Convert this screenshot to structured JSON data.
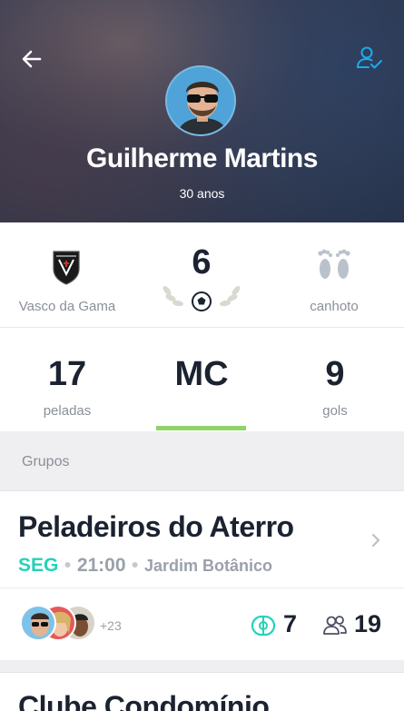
{
  "profile": {
    "name": "Guilherme Martins",
    "age": "30 anos",
    "club": "Vasco da Gama",
    "shirt_number": "6",
    "foot": "canhoto"
  },
  "stats": {
    "games_value": "17",
    "games_label": "peladas",
    "position": "MC",
    "goals_value": "9",
    "goals_label": "gols"
  },
  "groups_section": {
    "label": "Grupos"
  },
  "groups": [
    {
      "name": "Peladeiros do Aterro",
      "day": "SEG",
      "time": "21:00",
      "place": "Jardim Botânico",
      "more_members": "+23",
      "fields": "7",
      "members": "19"
    },
    {
      "name": "Clube Condomínio"
    }
  ],
  "colors": {
    "accent_teal": "#25d2b8",
    "accent_blue": "#1fa9e8",
    "position_underline": "#8fd36a"
  },
  "icons": {
    "back": "arrow-left-icon",
    "profile_action": "user-check-icon",
    "club": "vasco-crest-icon",
    "ball": "soccer-ball-icon",
    "foot": "footprints-icon",
    "field": "soccer-field-icon",
    "people": "people-icon",
    "chevron": "chevron-right-icon"
  }
}
